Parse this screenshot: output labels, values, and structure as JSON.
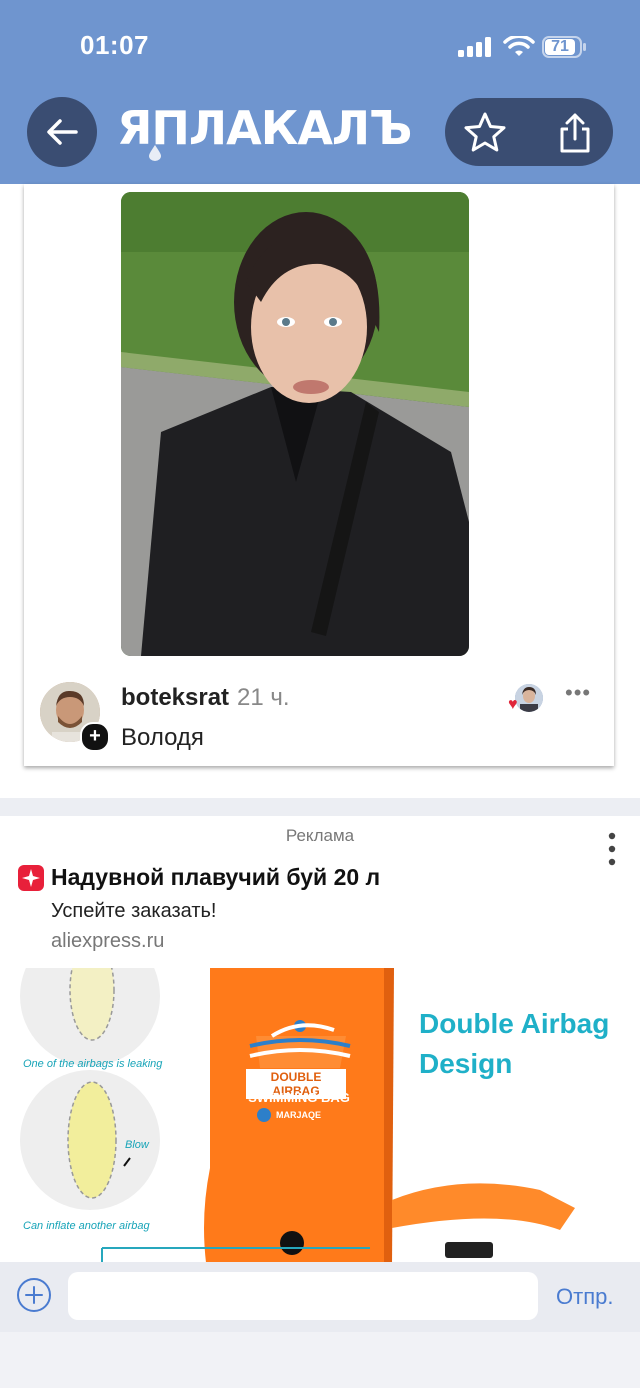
{
  "status_bar": {
    "time": "01:07",
    "battery": "71"
  },
  "header": {
    "logo": "ЯПЛАКАЛЪ"
  },
  "post": {
    "username": "boteksrat",
    "time_ago": "21 ч.",
    "caption": "Володя"
  },
  "ad": {
    "label": "Реклама",
    "title": "Надувной плавучий буй 20 л",
    "subtitle": "Успейте заказать!",
    "domain": "aliexpress.ru",
    "image": {
      "caption_leaking": "One of the airbags is leaking",
      "caption_blow": "Blow",
      "caption_inflate": "Can inflate another airbag",
      "headline_line1": "Double Airbag",
      "headline_line2": "Design",
      "bag_label_1": "DOUBLE AIRBAG",
      "bag_label_2": "SWIMMING BAG",
      "bag_brand": "MARJAQE"
    }
  },
  "composer": {
    "send_label": "Отпр."
  }
}
